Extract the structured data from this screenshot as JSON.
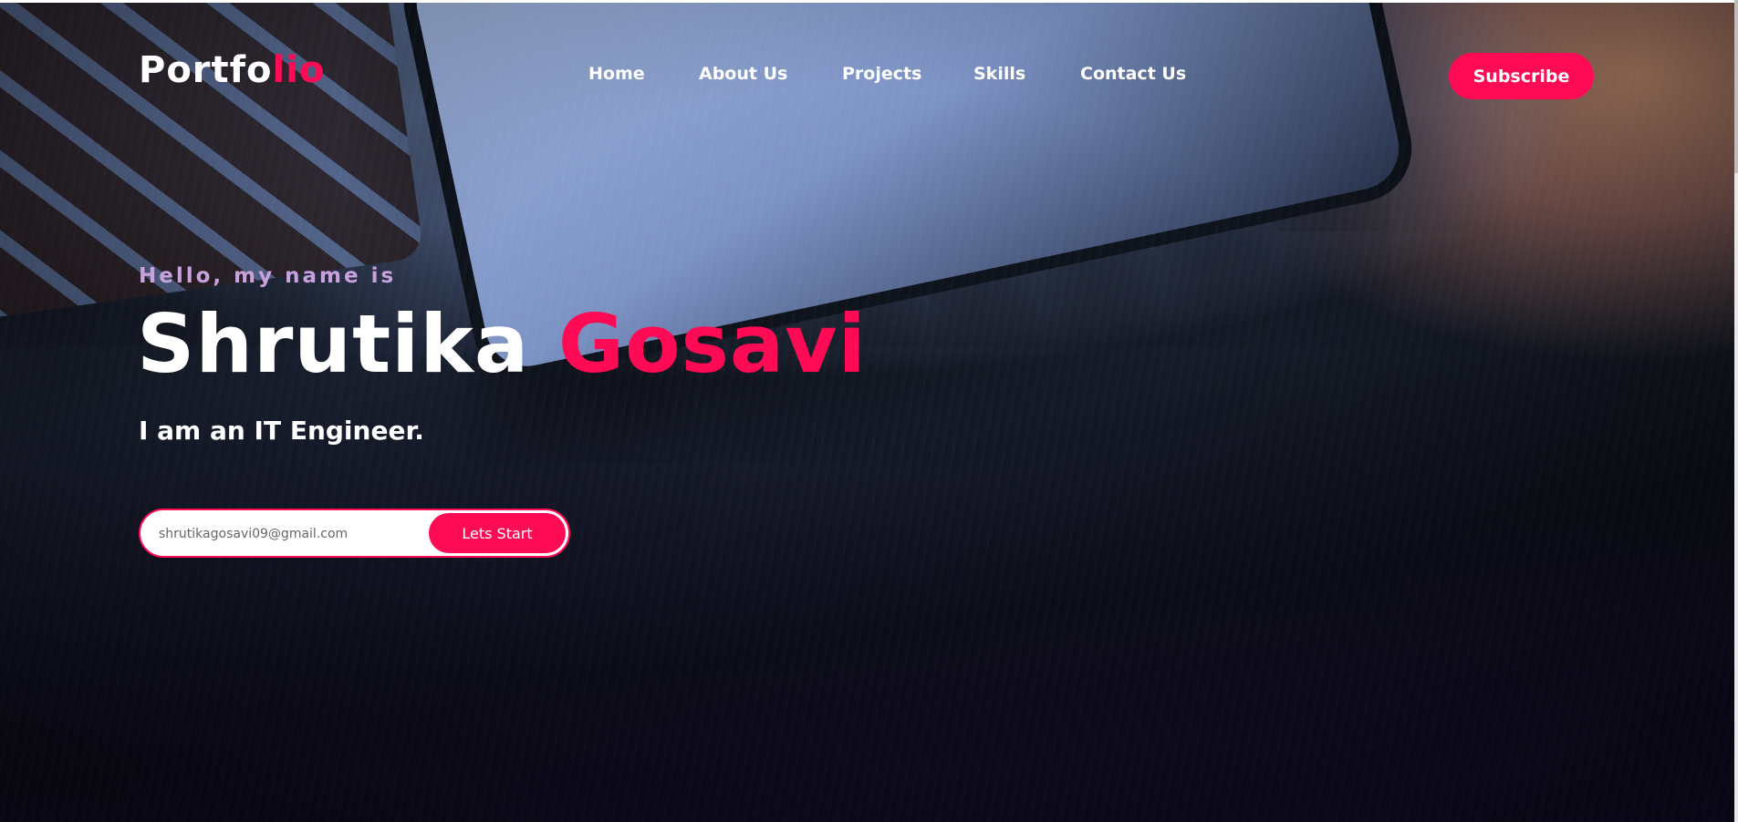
{
  "colors": {
    "accent": "#ff0a55",
    "greeting": "#c9a2dd",
    "text": "#ffffff"
  },
  "header": {
    "logo_main": "Portfo",
    "logo_accent": "lio",
    "nav": [
      "Home",
      "About Us",
      "Projects",
      "Skills",
      "Contact Us"
    ],
    "subscribe_label": "Subscribe"
  },
  "hero": {
    "greeting": "Hello, my name is",
    "first_name": "Shrutika",
    "last_name": "Gosavi",
    "role": "I am an IT Engineer.",
    "email_value": "shrutikagosavi09@gmail.com",
    "start_label": "Lets Start"
  }
}
